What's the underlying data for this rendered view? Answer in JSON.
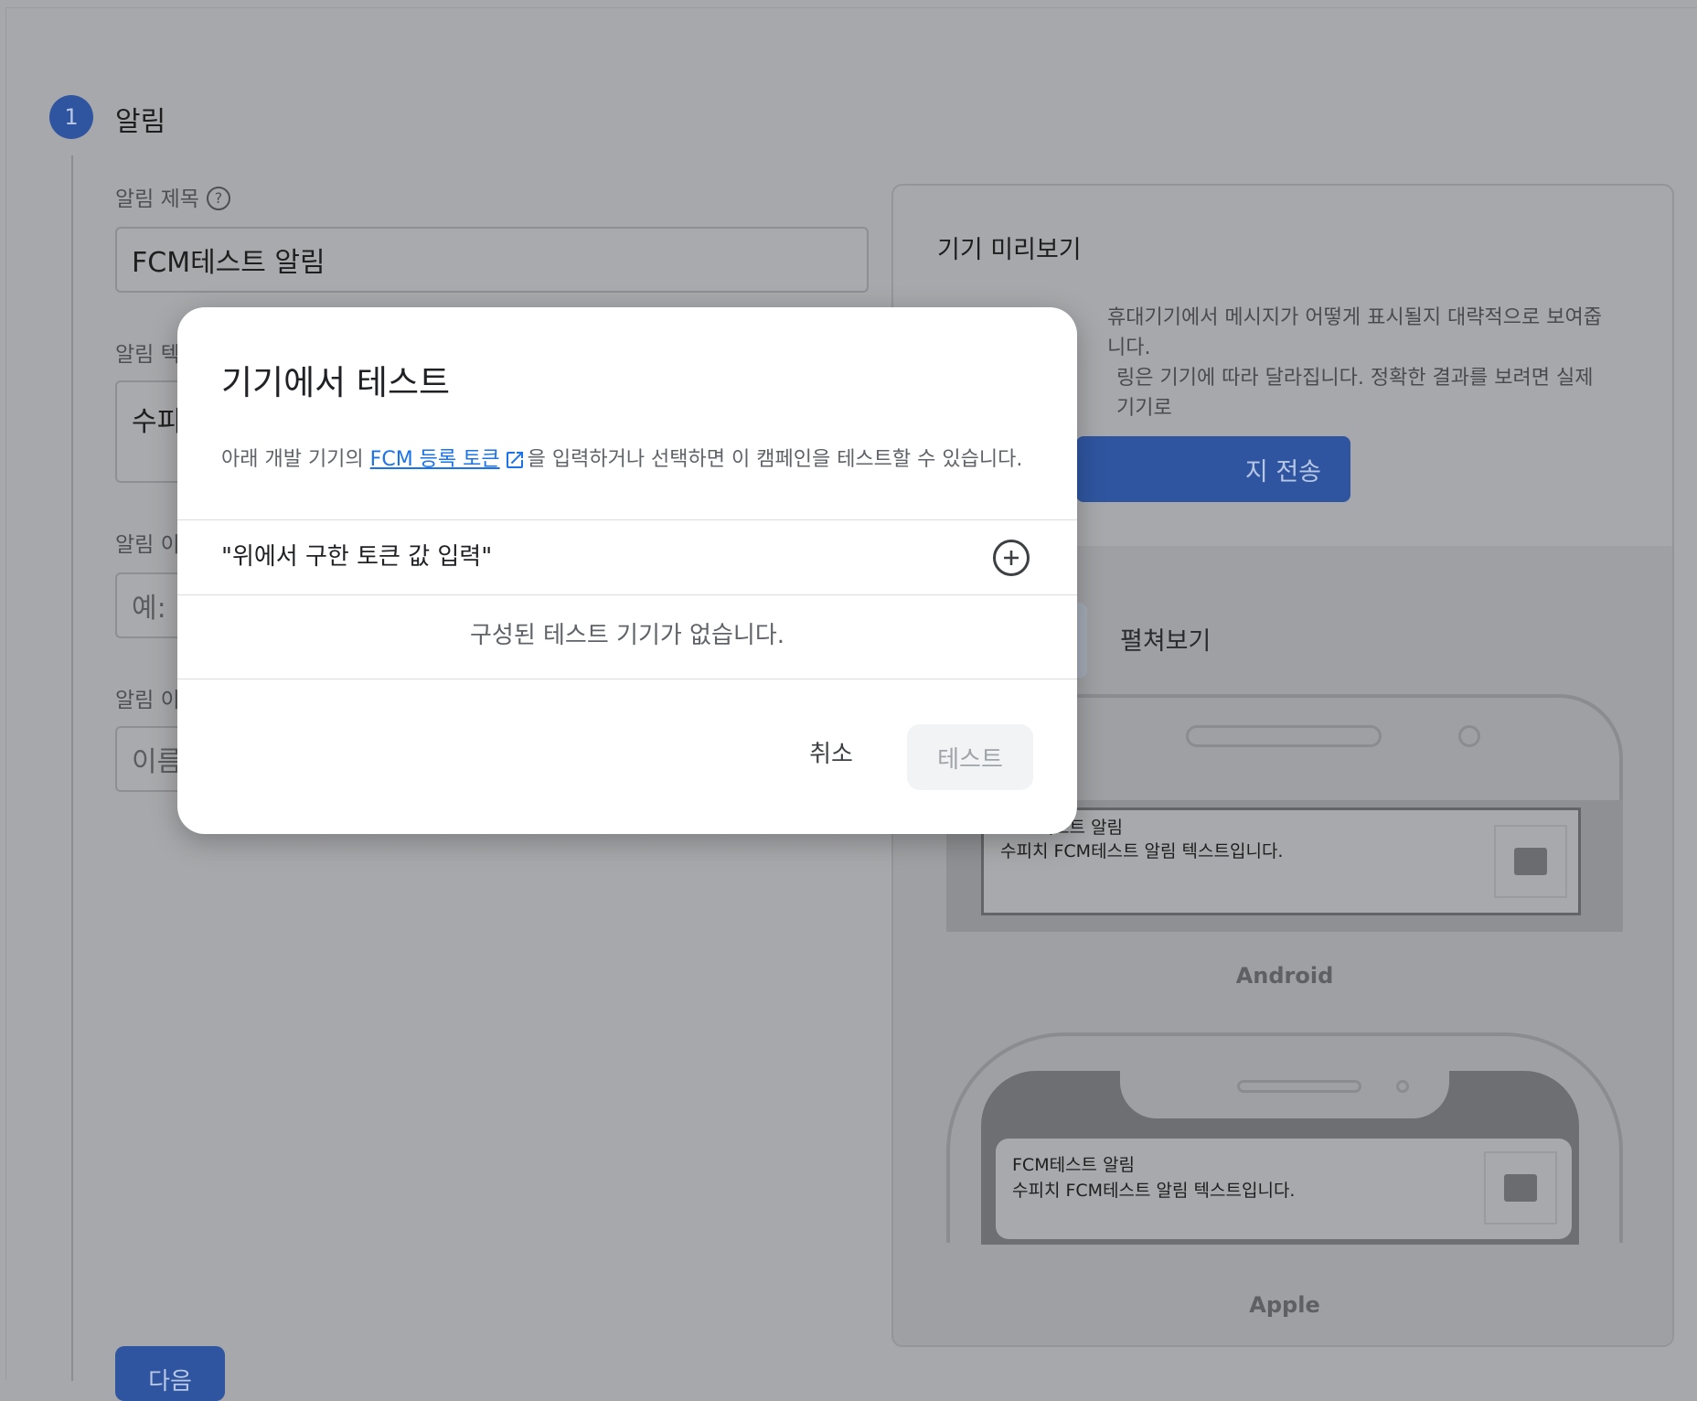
{
  "step": {
    "number": "1",
    "title": "알림"
  },
  "form": {
    "title_label": "알림 제목",
    "title_help_icon": "help-circle-icon",
    "title_value": "FCM테스트 알림",
    "text_label": "알림 텍",
    "text_value": "수피",
    "image_label": "알림 이",
    "image_placeholder": "예: h",
    "name_label": "알림 이",
    "name_placeholder": "이름",
    "next_button": "다음"
  },
  "preview": {
    "title": "기기 미리보기",
    "description_line1": "휴대기기에서 메시지가 어떻게 표시될지 대략적으로 보여줍니다.",
    "description_line2": "링은 기기에 따라 달라집니다. 정확한 결과를 보려면 실제 기기로",
    "send_button": "지 전송",
    "expand_toggle": "펼쳐보기",
    "android": {
      "notif_title": "FCM테스트 알림",
      "notif_body": "수피치 FCM테스트 알림 텍스트입니다.",
      "caption": "Android"
    },
    "apple": {
      "notif_title": "FCM테스트 알림",
      "notif_body": "수피치 FCM테스트 알림 텍스트입니다.",
      "caption": "Apple"
    }
  },
  "modal": {
    "title": "기기에서 테스트",
    "desc_before": "아래 개발 기기의 ",
    "desc_link": "FCM 등록 토큰",
    "desc_after": "을 입력하거나 선택하면 이 캠페인을 테스트할 수 있습니다.",
    "token_input_value": "\"위에서 구한 토큰 값 입력\"",
    "empty_text": "구성된 테스트 기기가 없습니다.",
    "cancel_button": "취소",
    "test_button": "테스트"
  },
  "colors": {
    "accent": "#1a73e8",
    "overlay_blue": "#2f55a0",
    "scrim_bg": "#a7a8ab"
  }
}
